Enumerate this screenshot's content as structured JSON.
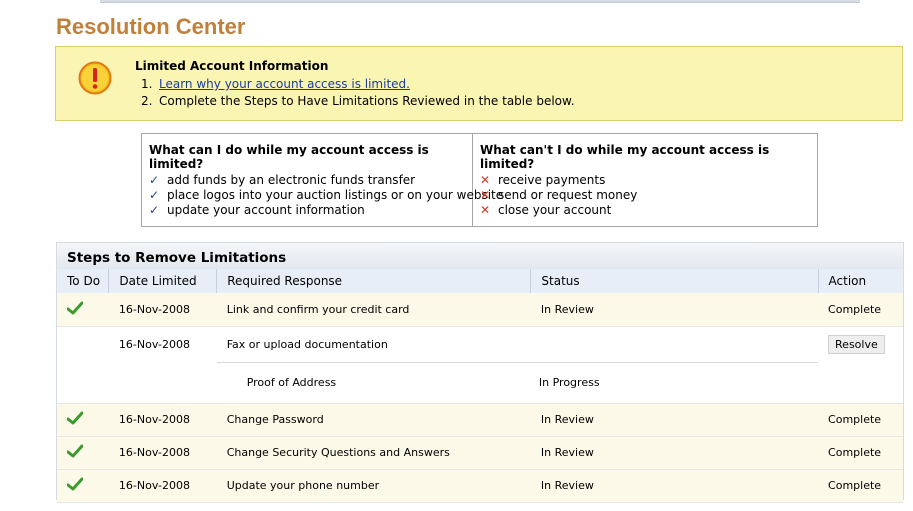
{
  "page": {
    "title": "Resolution Center"
  },
  "alert": {
    "title": "Limited Account Information",
    "items": [
      {
        "num": "1.",
        "text": "Learn why your account access is limited.",
        "link": true
      },
      {
        "num": "2.",
        "text": "Complete the Steps to Have Limitations Reviewed in the table below.",
        "link": false
      }
    ]
  },
  "limits": {
    "can": {
      "title": "What can I do while my account access is limited?",
      "items": [
        "add funds by an electronic funds transfer",
        "place logos into your auction listings or on your website",
        "update your account information"
      ]
    },
    "cant": {
      "title": "What can't I do while my account access is limited?",
      "items": [
        "receive payments",
        "send or request money",
        "close your account"
      ]
    }
  },
  "steps": {
    "title": "Steps to Remove Limitations",
    "columns": [
      "To Do",
      "Date Limited",
      "Required Response",
      "Status",
      "Action"
    ],
    "rows": [
      {
        "done": true,
        "date": "16-Nov-2008",
        "response": "Link and confirm your credit card",
        "status": "In Review",
        "action": "Complete"
      },
      {
        "done": false,
        "date": "16-Nov-2008",
        "response": "Fax or upload documentation",
        "status": "",
        "action": "Resolve",
        "sub": {
          "response": "Proof of Address",
          "status": "In Progress"
        }
      },
      {
        "done": true,
        "date": "16-Nov-2008",
        "response": "Change Password",
        "status": "In Review",
        "action": "Complete"
      },
      {
        "done": true,
        "date": "16-Nov-2008",
        "response": "Change Security Questions and Answers",
        "status": "In Review",
        "action": "Complete"
      },
      {
        "done": true,
        "date": "16-Nov-2008",
        "response": "Update your phone number",
        "status": "In Review",
        "action": "Complete"
      }
    ]
  },
  "colors": {
    "title": "#c0803a",
    "alert_bg": "#fbf5b4",
    "link": "#1a3c9a",
    "check_green": "#3a9a2a",
    "x_red": "#d23a2a"
  }
}
